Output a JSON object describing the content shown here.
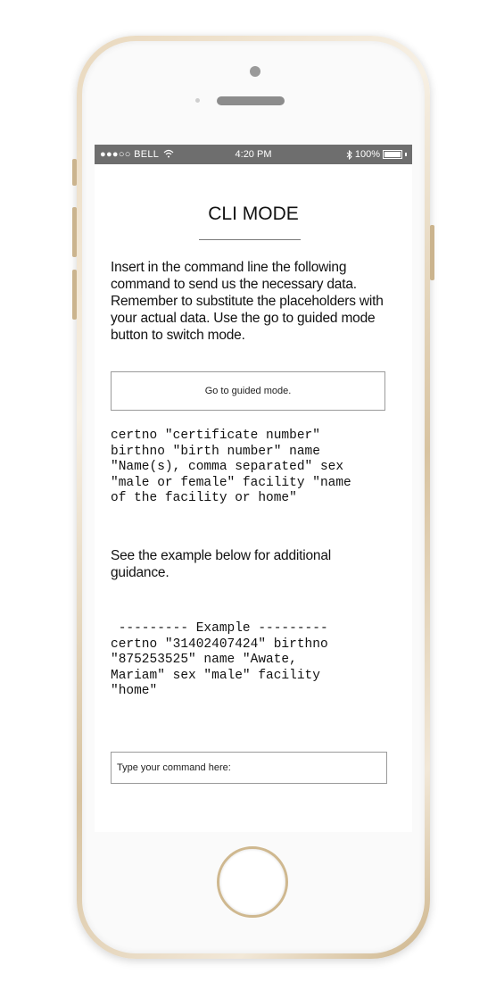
{
  "statusbar": {
    "carrier": "●●●○○ BELL",
    "time": "4:20 PM",
    "battery": "100%",
    "battery_level": 1.0
  },
  "screen": {
    "title": "CLI MODE",
    "instructions": "Insert in the command line the following command to send us the necessary data. Remember to substitute the placeholders with your actual data. Use the go to guided mode button to switch mode.",
    "guided_button_label": "Go to guided mode.",
    "command_template": "certno \"certificate number\"\nbirthno \"birth number\" name\n\"Name(s), comma separated\" sex\n\"male or female\" facility \"name\nof the facility or home\"",
    "guidance_text": "See the example below for additional guidance.",
    "example": " --------- Example ---------\ncertno \"31402407424\" birthno\n\"875253525\" name \"Awate,\nMariam\" sex \"male\" facility\n\"home\"",
    "command_input_placeholder": "Type your command here:"
  }
}
